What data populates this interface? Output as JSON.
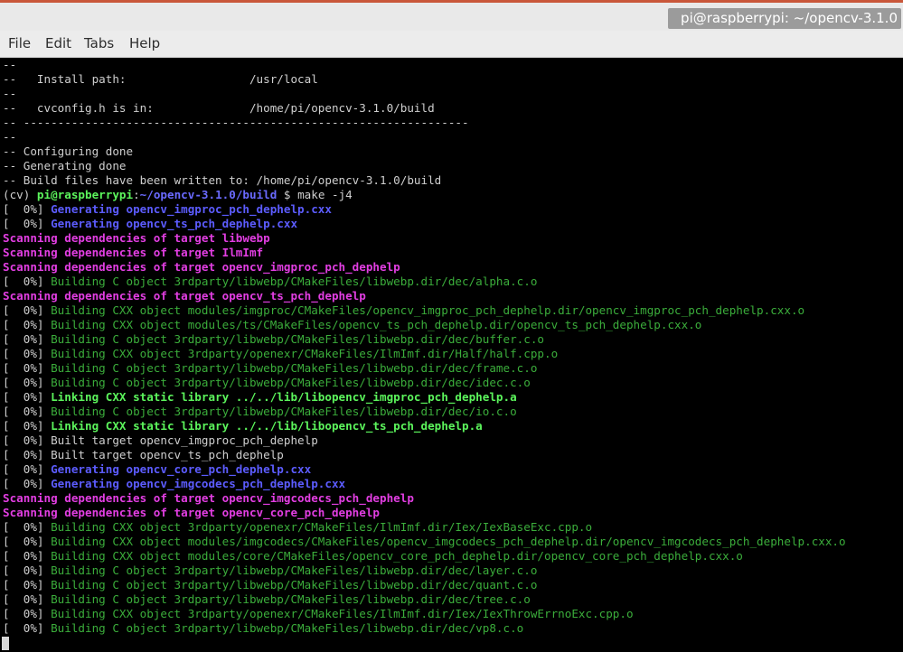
{
  "window": {
    "title": "pi@raspberrypi: ~/opencv-3.1.0"
  },
  "menu": {
    "file": "File",
    "edit": "Edit",
    "tabs": "Tabs",
    "help": "Help"
  },
  "colors": {
    "white": "#cfcfcf",
    "blue": "#5c5cff",
    "magenta": "#e23ee2",
    "green": "#3bad3b",
    "bright_green": "#5cf55c"
  },
  "lines": [
    "--",
    "--   Install path:                  /usr/local",
    "--",
    "--   cvconfig.h is in:              /home/pi/opencv-3.1.0/build",
    "-- -----------------------------------------------------------------",
    "--",
    "-- Configuring done",
    "-- Generating done",
    "-- Build files have been written to: /home/pi/opencv-3.1.0/build",
    "[  0%] ",
    "[  0%] ",
    "Scanning dependencies of target libwebp",
    "Scanning dependencies of target IlmImf",
    "Scanning dependencies of target opencv_imgproc_pch_dephelp",
    "[  0%] ",
    "Scanning dependencies of target opencv_ts_pch_dephelp",
    "[  0%] ",
    "[  0%] ",
    "[  0%] ",
    "[  0%] ",
    "[  0%] ",
    "[  0%] ",
    "[  0%] ",
    "[  0%] ",
    "[  0%] ",
    "[  0%] Built target opencv_imgproc_pch_dephelp",
    "[  0%] Built target opencv_ts_pch_dephelp",
    "[  0%] ",
    "[  0%] ",
    "Scanning dependencies of target opencv_imgcodecs_pch_dephelp",
    "Scanning dependencies of target opencv_core_pch_dephelp",
    "[  0%] ",
    "[  0%] ",
    "[  0%] ",
    "[  0%] ",
    "[  0%] ",
    "[  0%] ",
    "[  0%] ",
    "[  0%] "
  ],
  "prompt": {
    "env": "(cv) ",
    "userhost": "pi@raspberrypi",
    "colon": ":",
    "path": "~/opencv-3.1.0/build",
    "dollar": " $ ",
    "command": "make -j4"
  },
  "msgs": {
    "gen_imgproc": "Generating opencv_imgproc_pch_dephelp.cxx",
    "gen_ts": "Generating opencv_ts_pch_dephelp.cxx",
    "b_alpha": "Building C object 3rdparty/libwebp/CMakeFiles/libwebp.dir/dec/alpha.c.o",
    "b_imgproc": "Building CXX object modules/imgproc/CMakeFiles/opencv_imgproc_pch_dephelp.dir/opencv_imgproc_pch_dephelp.cxx.o",
    "b_ts": "Building CXX object modules/ts/CMakeFiles/opencv_ts_pch_dephelp.dir/opencv_ts_pch_dephelp.cxx.o",
    "b_buffer": "Building C object 3rdparty/libwebp/CMakeFiles/libwebp.dir/dec/buffer.c.o",
    "b_half": "Building CXX object 3rdparty/openexr/CMakeFiles/IlmImf.dir/Half/half.cpp.o",
    "b_frame": "Building C object 3rdparty/libwebp/CMakeFiles/libwebp.dir/dec/frame.c.o",
    "b_idec": "Building C object 3rdparty/libwebp/CMakeFiles/libwebp.dir/dec/idec.c.o",
    "link_imgproc": "Linking CXX static library ../../lib/libopencv_imgproc_pch_dephelp.a",
    "b_io": "Building C object 3rdparty/libwebp/CMakeFiles/libwebp.dir/dec/io.c.o",
    "link_ts": "Linking CXX static library ../../lib/libopencv_ts_pch_dephelp.a",
    "gen_core": "Generating opencv_core_pch_dephelp.cxx",
    "gen_imgcodecs": "Generating opencv_imgcodecs_pch_dephelp.cxx",
    "b_iexbase": "Building CXX object 3rdparty/openexr/CMakeFiles/IlmImf.dir/Iex/IexBaseExc.cpp.o",
    "b_imgcodecs": "Building CXX object modules/imgcodecs/CMakeFiles/opencv_imgcodecs_pch_dephelp.dir/opencv_imgcodecs_pch_dephelp.cxx.o",
    "b_core": "Building CXX object modules/core/CMakeFiles/opencv_core_pch_dephelp.dir/opencv_core_pch_dephelp.cxx.o",
    "b_layer": "Building C object 3rdparty/libwebp/CMakeFiles/libwebp.dir/dec/layer.c.o",
    "b_quant": "Building C object 3rdparty/libwebp/CMakeFiles/libwebp.dir/dec/quant.c.o",
    "b_tree": "Building C object 3rdparty/libwebp/CMakeFiles/libwebp.dir/dec/tree.c.o",
    "b_iexthrow": "Building CXX object 3rdparty/openexr/CMakeFiles/IlmImf.dir/Iex/IexThrowErrnoExc.cpp.o",
    "b_vp8": "Building C object 3rdparty/libwebp/CMakeFiles/libwebp.dir/dec/vp8.c.o"
  }
}
